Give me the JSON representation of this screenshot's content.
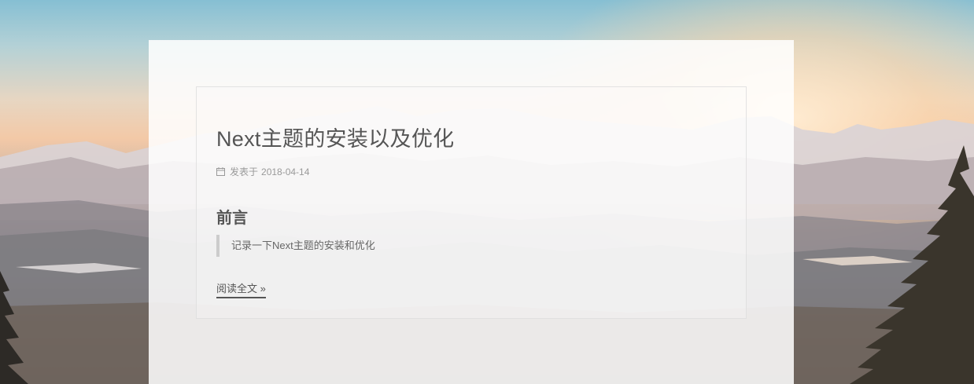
{
  "background": {
    "description_colors": {
      "sky": "#86bfd3",
      "glow": "#f3c9a7",
      "mountains": "#9c9195"
    }
  },
  "post": {
    "title": "Next主题的安装以及优化",
    "meta_icon": "calendar-icon",
    "meta_label": "发表于",
    "date": "2018-04-14",
    "section_heading": "前言",
    "excerpt": "记录一下Next主题的安装和优化",
    "read_more": "阅读全文 »"
  },
  "colors": {
    "title": "#555555",
    "meta": "#999999",
    "quote_border": "#cccccc"
  }
}
